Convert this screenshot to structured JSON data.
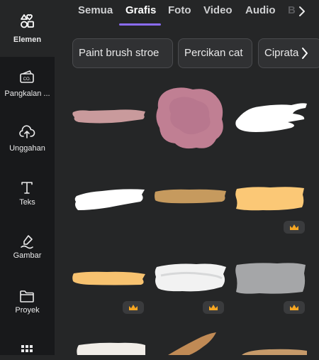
{
  "sidebar": {
    "items": [
      {
        "label": "Elemen",
        "icon": "elements-icon"
      },
      {
        "label": "Pangkalan ...",
        "icon": "brand-kit-icon"
      },
      {
        "label": "Unggahan",
        "icon": "upload-cloud-icon"
      },
      {
        "label": "Teks",
        "icon": "text-icon"
      },
      {
        "label": "Gambar",
        "icon": "draw-pen-icon"
      },
      {
        "label": "Proyek",
        "icon": "folder-icon"
      },
      {
        "label": "",
        "icon": "apps-grid-icon"
      }
    ]
  },
  "tabs": [
    {
      "label": "Semua"
    },
    {
      "label": "Grafis"
    },
    {
      "label": "Foto"
    },
    {
      "label": "Video"
    },
    {
      "label": "Audio"
    },
    {
      "label": "B"
    }
  ],
  "chips": [
    {
      "label": "Paint brush stroe"
    },
    {
      "label": "Percikan cat"
    },
    {
      "label": "Ciprata"
    }
  ],
  "grid": {
    "tiles": [
      {
        "name": "brush-stroke-pink",
        "color": "#c99a9c"
      },
      {
        "name": "paint-splash-pink",
        "color": "#c07f93"
      },
      {
        "name": "brush-stroke-white-1",
        "color": "#ffffff"
      },
      {
        "name": "brush-stroke-white-2",
        "color": "#ffffff"
      },
      {
        "name": "brush-stroke-tan",
        "color": "#c69a5e"
      },
      {
        "name": "brush-stroke-yellow-1",
        "color": "#fbc876",
        "premium": true
      },
      {
        "name": "brush-stroke-yellow-2",
        "color": "#f7c270",
        "premium": true
      },
      {
        "name": "brush-stroke-white-grey",
        "color": "#f2f2f2",
        "premium": true
      },
      {
        "name": "brush-stroke-grey",
        "color": "#a5a6a8",
        "premium": true
      },
      {
        "name": "brush-stroke-cream",
        "color": "#f1ede8"
      },
      {
        "name": "brush-stroke-brown",
        "color": "#c08a55"
      },
      {
        "name": "brush-stroke-tan-2",
        "color": "#c69a6a"
      }
    ]
  },
  "colors": {
    "accent": "#8b6cf6",
    "sidebar_bg": "#18191b",
    "panel_bg": "#252627",
    "crown": "#f5a623"
  }
}
